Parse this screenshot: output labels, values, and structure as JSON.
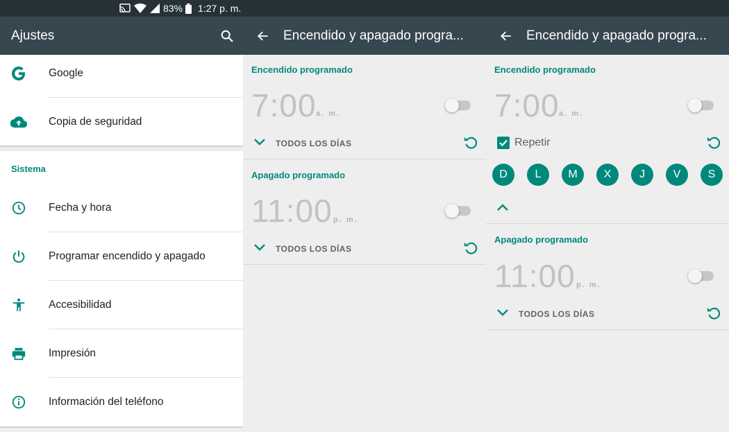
{
  "status_bar": {
    "battery": "83%",
    "time": "1:27 p. m."
  },
  "settings": {
    "title": "Ajustes",
    "top_items": [
      {
        "label": "Google",
        "icon": "google-icon"
      },
      {
        "label": "Copia de seguridad",
        "icon": "cloud-upload-icon"
      }
    ],
    "section_title": "Sistema",
    "system_items": [
      {
        "label": "Fecha y hora",
        "icon": "clock-icon"
      },
      {
        "label": "Programar encendido y apagado",
        "icon": "power-icon"
      },
      {
        "label": "Accesibilidad",
        "icon": "accessibility-icon"
      },
      {
        "label": "Impresión",
        "icon": "printer-icon"
      },
      {
        "label": "Información del teléfono",
        "icon": "info-icon"
      }
    ]
  },
  "schedule": {
    "title": "Encendido y apagado progra...",
    "power_on": {
      "heading": "Encendido programado",
      "time": "7:00",
      "period": "a. m.",
      "repeat_text": "TODOS LOS DÍAS"
    },
    "power_off": {
      "heading": "Apagado programado",
      "time": "11:00",
      "period": "p. m.",
      "repeat_text": "TODOS LOS DÍAS"
    },
    "repeat_label": "Repetir",
    "days": [
      "D",
      "L",
      "M",
      "X",
      "J",
      "V",
      "S"
    ]
  },
  "colors": {
    "accent": "#00897b",
    "toolbar": "#37474f",
    "statusbar": "#263238"
  }
}
